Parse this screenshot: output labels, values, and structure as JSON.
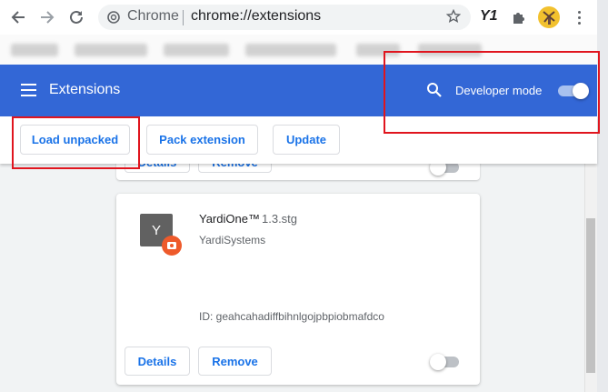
{
  "browser": {
    "omnibox_app": "Chrome",
    "omnibox_url": "chrome://extensions",
    "extension_badge": "Y1"
  },
  "header": {
    "title": "Extensions",
    "developer_mode_label": "Developer mode",
    "developer_mode_on": true,
    "color": "#3367d6"
  },
  "toolbar": {
    "load_unpacked": "Load unpacked",
    "pack_extension": "Pack extension",
    "update": "Update"
  },
  "previous_card": {
    "details_label": "Details",
    "remove_label": "Remove",
    "enabled": false
  },
  "extension": {
    "icon_letter": "Y",
    "name": "YardiOne™",
    "version": "1.3.stg",
    "publisher": "YardiSystems",
    "id_text": "ID: geahcahadiffbihnlgojpbpiobmafdco",
    "details_label": "Details",
    "remove_label": "Remove",
    "enabled": false
  },
  "annotations": {
    "highlight_color": "#e0151e"
  }
}
